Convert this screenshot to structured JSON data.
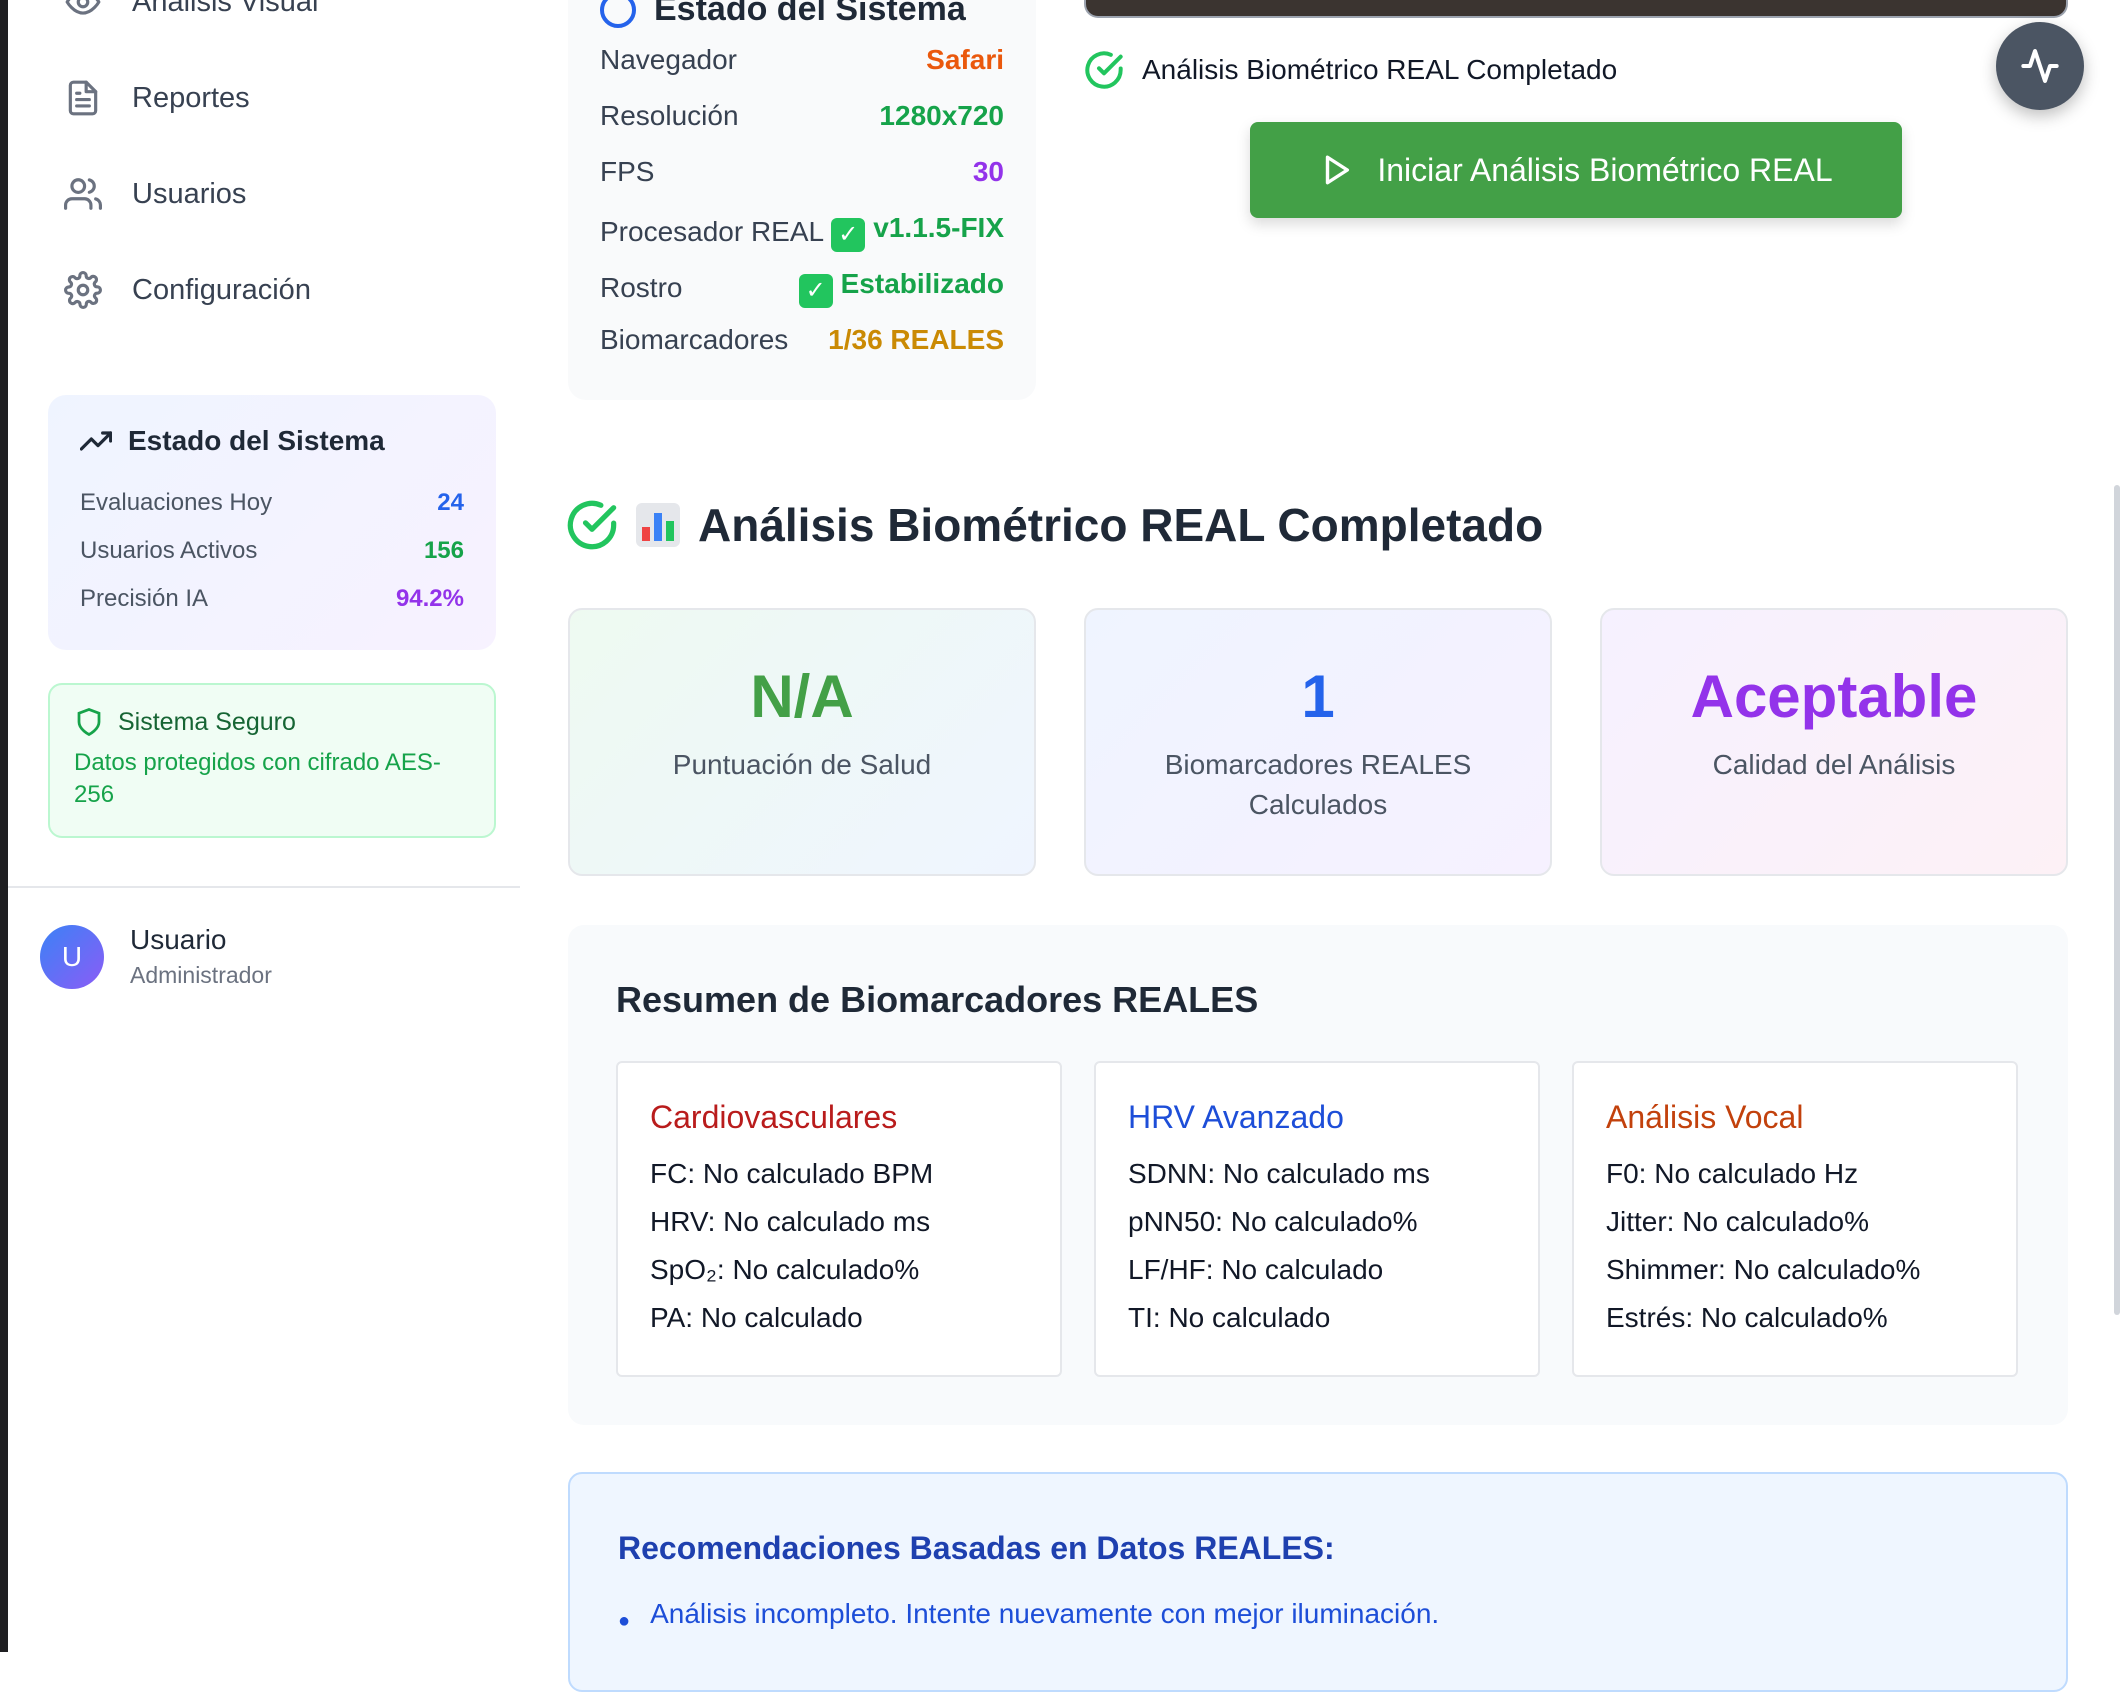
{
  "sidebar": {
    "nav": [
      {
        "label": "Análisis Visual",
        "icon": "eye-icon"
      },
      {
        "label": "Reportes",
        "icon": "document-icon"
      },
      {
        "label": "Usuarios",
        "icon": "users-icon"
      },
      {
        "label": "Configuración",
        "icon": "gear-icon"
      }
    ],
    "status": {
      "title": "Estado del Sistema",
      "rows": [
        {
          "label": "Evaluaciones Hoy",
          "value": "24",
          "color": "#2563eb"
        },
        {
          "label": "Usuarios Activos",
          "value": "156",
          "color": "#16a34a"
        },
        {
          "label": "Precisión IA",
          "value": "94.2%",
          "color": "#9333ea"
        }
      ]
    },
    "secure": {
      "title": "Sistema Seguro",
      "text": "Datos protegidos con cifrado AES-256"
    },
    "user": {
      "initial": "U",
      "name": "Usuario",
      "role": "Administrador"
    }
  },
  "system_card": {
    "title": "Estado del Sistema",
    "rows": [
      {
        "label": "Navegador",
        "value": "Safari",
        "color": "#ea580c"
      },
      {
        "label": "Resolución",
        "value": "1280x720",
        "color": "#16a34a"
      },
      {
        "label": "FPS",
        "value": "30",
        "color": "#9333ea"
      },
      {
        "label": "Procesador REAL",
        "value": "v1.1.5-FIX",
        "color": "#16a34a",
        "check": true
      },
      {
        "label": "Rostro",
        "value": "Estabilizado",
        "color": "#16a34a",
        "check": true
      },
      {
        "label": "Biomarcadores",
        "value": "1/36 REALES",
        "color": "#ca8a04"
      }
    ]
  },
  "analysis": {
    "status_line": "Análisis Biométrico REAL Completado",
    "start_button": "Iniciar Análisis Biométrico REAL",
    "heading": "Análisis Biométrico REAL Completado"
  },
  "scores": [
    {
      "value": "N/A",
      "label": "Puntuación de Salud",
      "color": "#43a047",
      "bg": "linear-gradient(135deg,#eefaf1,#eff5ff)"
    },
    {
      "value": "1",
      "label": "Biomarcadores REALES Calculados",
      "color": "#2563eb",
      "bg": "linear-gradient(135deg,#eff4ff,#f6f1ff)"
    },
    {
      "value": "Aceptable",
      "label": "Calidad del Análisis",
      "color": "#9333ea",
      "bg": "linear-gradient(135deg,#f6f1ff,#fdf1f6)"
    }
  ],
  "summary": {
    "title": "Resumen de Biomarcadores REALES",
    "groups": [
      {
        "title": "Cardiovasculares",
        "color": "#b91c1c",
        "items": [
          "FC: No calculado BPM",
          "HRV: No calculado ms",
          "SpO₂: No calculado%",
          "PA: No calculado"
        ]
      },
      {
        "title": "HRV Avanzado",
        "color": "#1d4ed8",
        "items": [
          "SDNN: No calculado ms",
          "pNN50: No calculado%",
          "LF/HF: No calculado",
          "TI: No calculado"
        ]
      },
      {
        "title": "Análisis Vocal",
        "color": "#c2410c",
        "items": [
          "F0: No calculado Hz",
          "Jitter: No calculado%",
          "Shimmer: No calculado%",
          "Estrés: No calculado%"
        ]
      }
    ]
  },
  "recommendations": {
    "title": "Recomendaciones Basadas en Datos REALES:",
    "items": [
      "Análisis incompleto. Intente nuevamente con mejor iluminación."
    ]
  }
}
